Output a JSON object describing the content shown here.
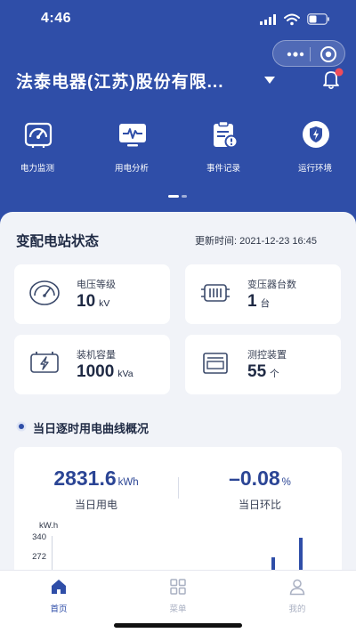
{
  "status_bar": {
    "time": "4:46"
  },
  "header": {
    "company": "法泰电器(江苏)股份有限...",
    "quick_nav": [
      {
        "label": "电力监测",
        "icon": "gauge-icon"
      },
      {
        "label": "用电分析",
        "icon": "monitor-pulse-icon"
      },
      {
        "label": "事件记录",
        "icon": "clipboard-alert-icon"
      },
      {
        "label": "运行环境",
        "icon": "shield-bolt-icon"
      }
    ]
  },
  "station": {
    "title": "变配电站状态",
    "update_time": "更新时间: 2021-12-23 16:45",
    "cards": [
      {
        "label": "电压等级",
        "value": "10",
        "unit": "kV",
        "icon": "meter-icon"
      },
      {
        "label": "变压器台数",
        "value": "1",
        "unit": "台",
        "icon": "transformer-icon"
      },
      {
        "label": "装机容量",
        "value": "1000",
        "unit": "kVa",
        "icon": "battery-bolt-icon"
      },
      {
        "label": "测控装置",
        "value": "55",
        "unit": "个",
        "icon": "device-icon"
      }
    ]
  },
  "curve": {
    "title": "当日逐时用电曲线概况",
    "kpis": [
      {
        "value": "2831.6",
        "unit": "kWh",
        "label": "当日用电"
      },
      {
        "value": "–0.08",
        "unit": "%",
        "label": "当日环比"
      }
    ],
    "chart_data": {
      "type": "bar",
      "ylabel": "kW.h",
      "y_ticks": [
        "340",
        "272"
      ],
      "values": [
        272,
        340
      ],
      "colors": {
        "bar": "#2f4ea8"
      }
    }
  },
  "tabbar": {
    "tabs": [
      {
        "label": "首页",
        "icon": "home-icon",
        "active": true
      },
      {
        "label": "菜单",
        "icon": "grid-icon",
        "active": false
      },
      {
        "label": "我的",
        "icon": "user-icon",
        "active": false
      }
    ]
  },
  "colors": {
    "primary": "#2f4ea8",
    "background": "#f1f3f8",
    "tab_inactive": "#a9b0c2"
  }
}
